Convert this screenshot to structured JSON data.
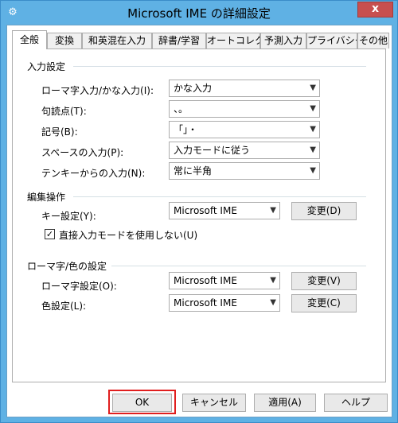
{
  "window": {
    "title": "Microsoft IME の詳細設定",
    "close_glyph": "x",
    "app_icon_glyph": "⚙"
  },
  "tabs": [
    {
      "label": "全般",
      "active": true
    },
    {
      "label": "変換"
    },
    {
      "label": "和英混在入力"
    },
    {
      "label": "辞書/学習"
    },
    {
      "label": "オートコレクト"
    },
    {
      "label": "予測入力"
    },
    {
      "label": "プライバシー"
    },
    {
      "label": "その他"
    }
  ],
  "input_settings": {
    "title": "入力設定",
    "romaji_kana": {
      "label": "ローマ字入力/かな入力(I):",
      "value": "かな入力"
    },
    "punctuation": {
      "label": "句読点(T):",
      "value": "、。"
    },
    "symbols": {
      "label": "記号(B):",
      "value": "「」・"
    },
    "space": {
      "label": "スペースの入力(P):",
      "value": "入力モードに従う"
    },
    "tenkey": {
      "label": "テンキーからの入力(N):",
      "value": "常に半角"
    }
  },
  "edit_ops": {
    "title": "編集操作",
    "key_setting": {
      "label": "キー設定(Y):",
      "value": "Microsoft IME",
      "change_button": "変更(D)"
    },
    "direct_input_checkbox": {
      "label": "直接入力モードを使用しない(U)",
      "checked": true
    }
  },
  "romaji_color": {
    "title": "ローマ字/色の設定",
    "romaji": {
      "label": "ローマ字設定(O):",
      "value": "Microsoft IME",
      "change_button": "変更(V)"
    },
    "color": {
      "label": "色設定(L):",
      "value": "Microsoft IME",
      "change_button": "変更(C)"
    }
  },
  "buttons": {
    "ok": "OK",
    "cancel": "キャンセル",
    "apply": "適用(A)",
    "help": "ヘルプ"
  },
  "colors": {
    "title_bar": "#5fb1e4",
    "close_button": "#c74f4f",
    "ok_highlight": "#e01e1e"
  }
}
